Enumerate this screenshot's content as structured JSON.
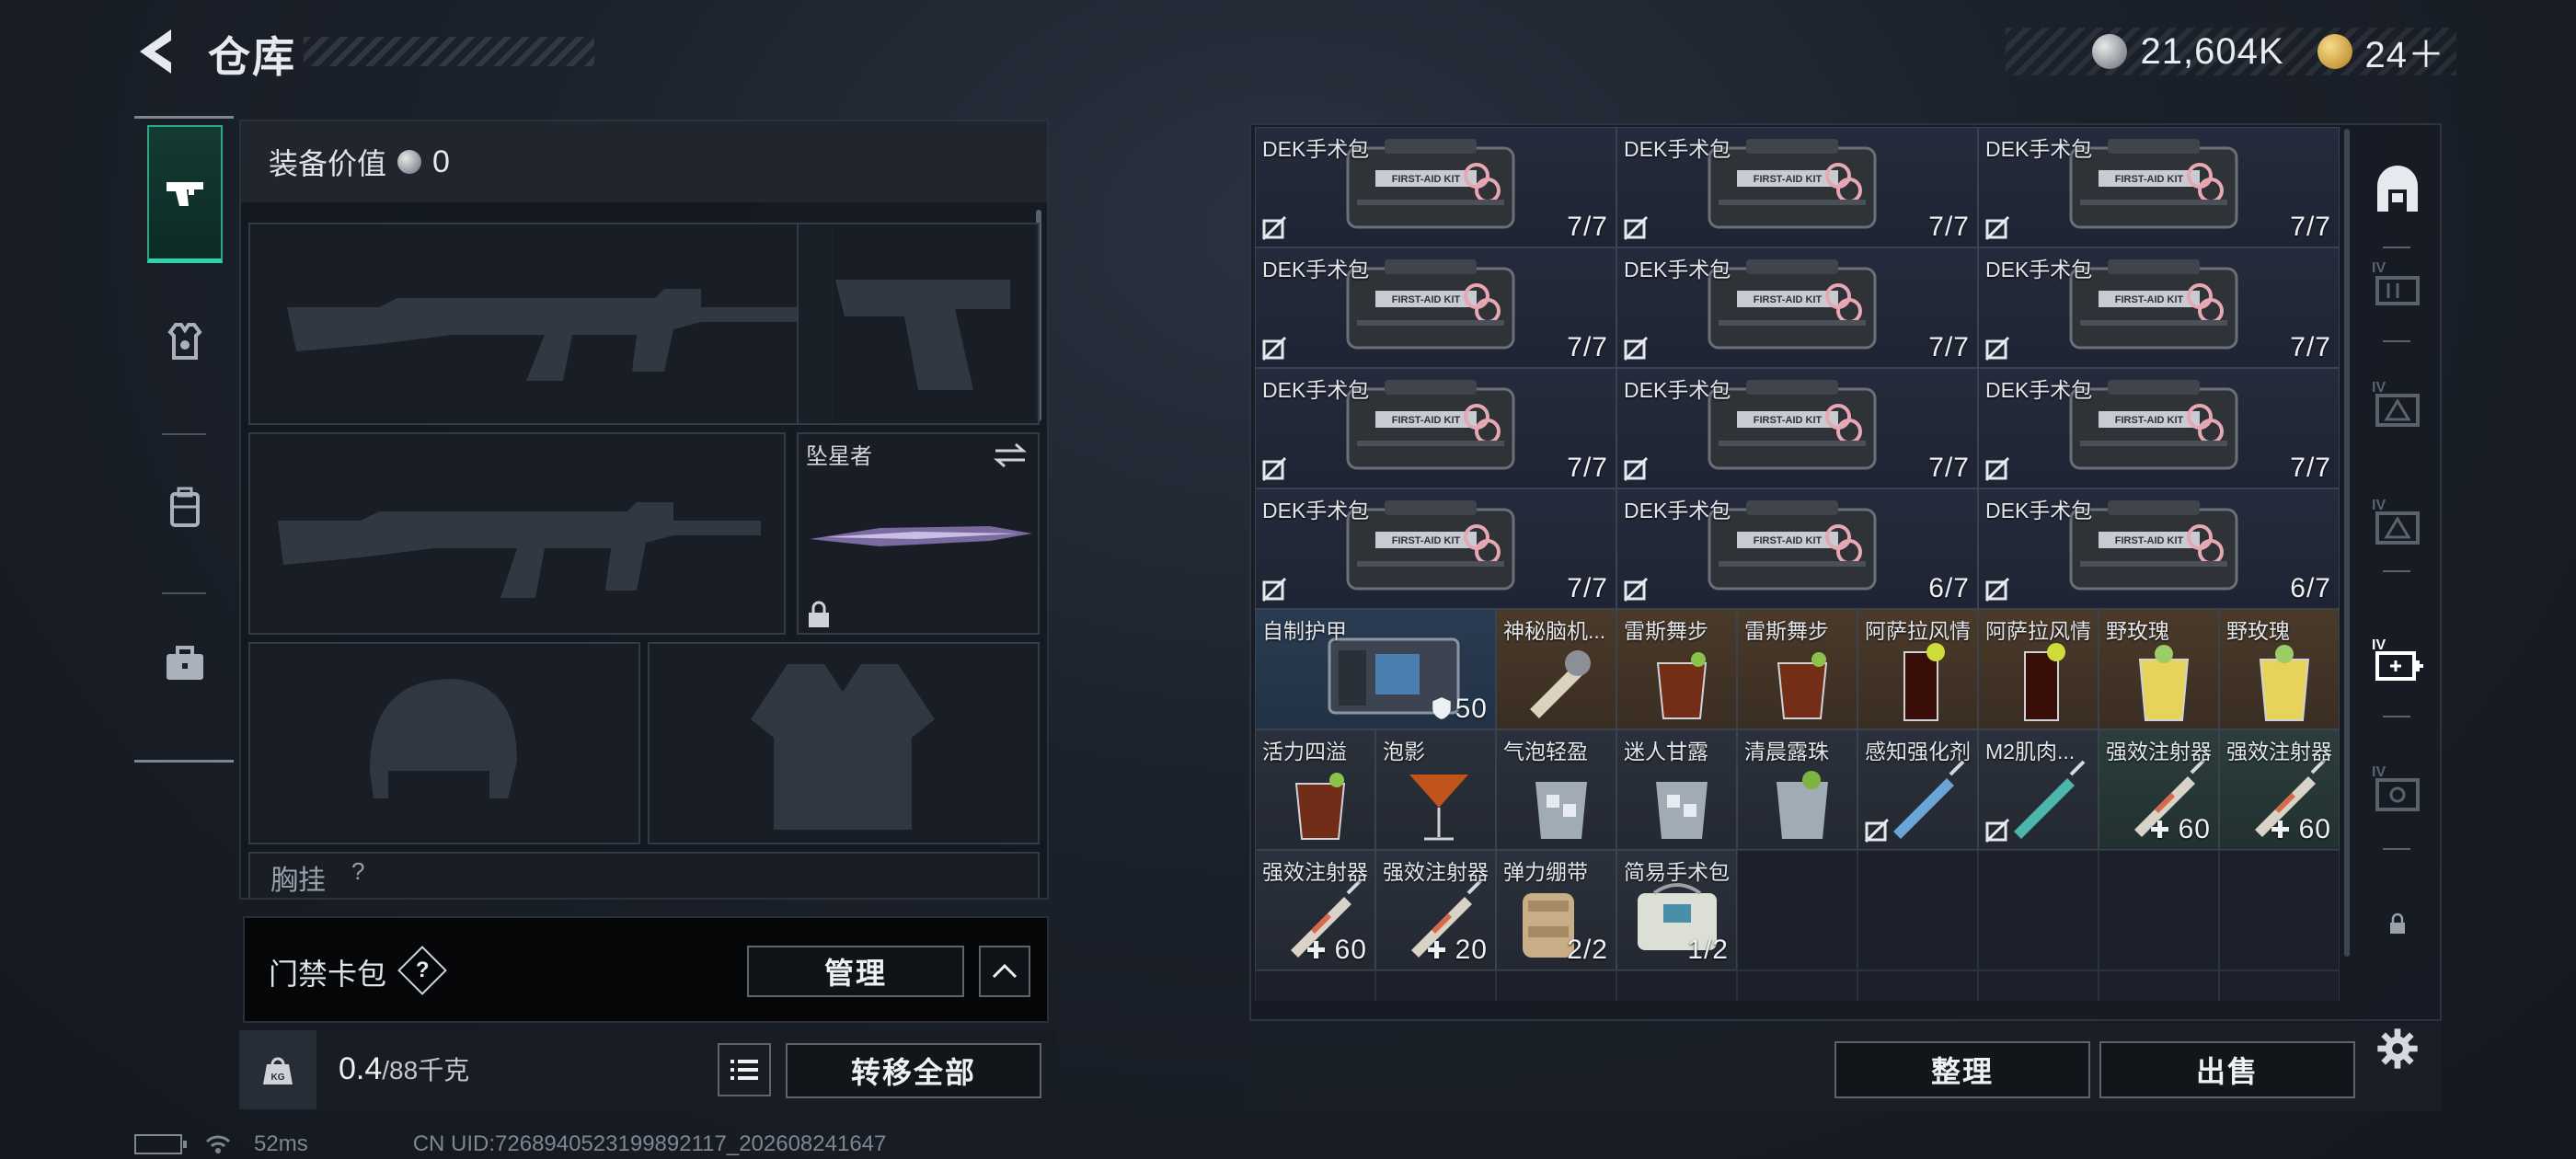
{
  "header": {
    "title": "仓库",
    "silver_amount": "21,604K",
    "gold_amount": "24＋"
  },
  "equipment": {
    "value_label": "装备价值",
    "value": "0",
    "melee_name": "坠星者",
    "chest_label": "胸挂",
    "chest_help": "?"
  },
  "keycard": {
    "label": "门禁卡包",
    "help": "?",
    "manage_label": "管理"
  },
  "weight": {
    "current": "0.4",
    "max": "/88千克",
    "transfer_all_label": "转移全部"
  },
  "grid": {
    "items": [
      {
        "name": "DEK手术包",
        "count": "7/7"
      },
      {
        "name": "DEK手术包",
        "count": "7/7"
      },
      {
        "name": "DEK手术包",
        "count": "7/7"
      },
      {
        "name": "DEK手术包",
        "count": "7/7"
      },
      {
        "name": "DEK手术包",
        "count": "7/7"
      },
      {
        "name": "DEK手术包",
        "count": "7/7"
      },
      {
        "name": "DEK手术包",
        "count": "7/7"
      },
      {
        "name": "DEK手术包",
        "count": "7/7"
      },
      {
        "name": "DEK手术包",
        "count": "7/7"
      },
      {
        "name": "DEK手术包",
        "count": "7/7"
      },
      {
        "name": "DEK手术包",
        "count": "6/7"
      },
      {
        "name": "DEK手术包",
        "count": "6/7"
      },
      {
        "name": "自制护甲",
        "count": "50"
      },
      {
        "name": "神秘脑机...",
        "count": ""
      },
      {
        "name": "雷斯舞步",
        "count": ""
      },
      {
        "name": "雷斯舞步",
        "count": ""
      },
      {
        "name": "阿萨拉风情",
        "count": ""
      },
      {
        "name": "阿萨拉风情",
        "count": ""
      },
      {
        "name": "野玫瑰",
        "count": ""
      },
      {
        "name": "野玫瑰",
        "count": ""
      },
      {
        "name": "活力四溢",
        "count": ""
      },
      {
        "name": "泡影",
        "count": ""
      },
      {
        "name": "气泡轻盈",
        "count": ""
      },
      {
        "name": "迷人甘露",
        "count": ""
      },
      {
        "name": "清晨露珠",
        "count": ""
      },
      {
        "name": "感知强化剂",
        "count": ""
      },
      {
        "name": "M2肌肉...",
        "count": ""
      },
      {
        "name": "强效注射器",
        "count": "60"
      },
      {
        "name": "强效注射器",
        "count": "60"
      },
      {
        "name": "强效注射器",
        "count": "60"
      },
      {
        "name": "强效注射器",
        "count": "20"
      },
      {
        "name": "弹力绷带",
        "count": "2/2"
      },
      {
        "name": "简易手术包",
        "count": "1/2"
      }
    ],
    "sort_label": "整理",
    "sell_label": "出售"
  },
  "status_bar": {
    "ping": "52ms",
    "uid": "CN UID:7268940523199892117_202608241647"
  },
  "colors": {
    "accent": "#2fd3a8",
    "panel": "#161b24"
  }
}
